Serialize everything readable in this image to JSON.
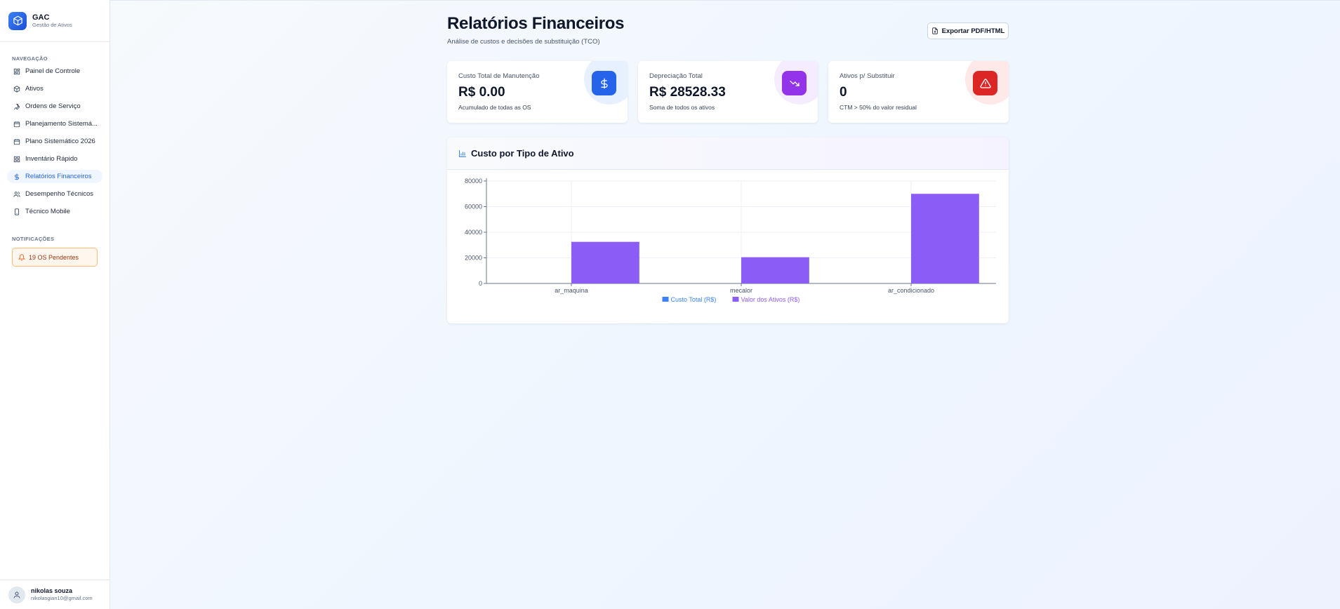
{
  "brand": {
    "name": "GAC",
    "subtitle": "Gestão de Ativos"
  },
  "sidebar": {
    "nav_label": "NAVEGAÇÃO",
    "items": [
      {
        "label": "Painel de Controle",
        "icon": "dashboard-icon"
      },
      {
        "label": "Ativos",
        "icon": "box-icon"
      },
      {
        "label": "Ordens de Serviço",
        "icon": "wrench-icon"
      },
      {
        "label": "Planejamento Sistemá...",
        "icon": "calendar-icon"
      },
      {
        "label": "Plano Sistemático 2026",
        "icon": "calendar-icon"
      },
      {
        "label": "Inventário Rápido",
        "icon": "grid-icon"
      },
      {
        "label": "Relatórios Financeiros",
        "icon": "dollar-icon",
        "active": true
      },
      {
        "label": "Desempenho Técnicos",
        "icon": "users-icon"
      },
      {
        "label": "Técnico Mobile",
        "icon": "smartphone-icon"
      }
    ],
    "notifications_label": "NOTIFICAÇÕES",
    "pending": "19 OS Pendentes"
  },
  "user": {
    "name": "nikolas souza",
    "email": "nikolasgian10@gmail.com"
  },
  "header": {
    "title": "Relatórios Financeiros",
    "subtitle": "Análise de custos e decisões de substituição (TCO)",
    "export_label": "Exportar PDF/HTML"
  },
  "cards": [
    {
      "label": "Custo Total de Manutenção",
      "value": "R$ 0.00",
      "note": "Acumulado de todas as OS",
      "icon": "dollar-icon",
      "color": "#2563eb"
    },
    {
      "label": "Depreciação Total",
      "value": "R$ 28528.33",
      "note": "Soma de todos os ativos",
      "icon": "trending-down-icon",
      "color": "#9333ea"
    },
    {
      "label": "Ativos p/ Substituir",
      "value": "0",
      "note": "CTM > 50% do valor residual",
      "icon": "alert-triangle-icon",
      "color": "#dc2626"
    }
  ],
  "chart_section": {
    "title": "Custo por Tipo de Ativo"
  },
  "chart_data": {
    "type": "bar",
    "categories": [
      "ar_maquina",
      "mecalor",
      "ar_condicionado"
    ],
    "series": [
      {
        "name": "Custo Total (R$)",
        "values": [
          0,
          0,
          0
        ],
        "color": "#3b82f6"
      },
      {
        "name": "Valor dos Ativos (R$)",
        "values": [
          32500,
          20500,
          70000
        ],
        "color": "#8b5cf6"
      }
    ],
    "yticks": [
      0,
      20000,
      40000,
      60000,
      80000
    ],
    "ylim": [
      0,
      80000
    ],
    "grid": true,
    "legend": "bottom"
  }
}
